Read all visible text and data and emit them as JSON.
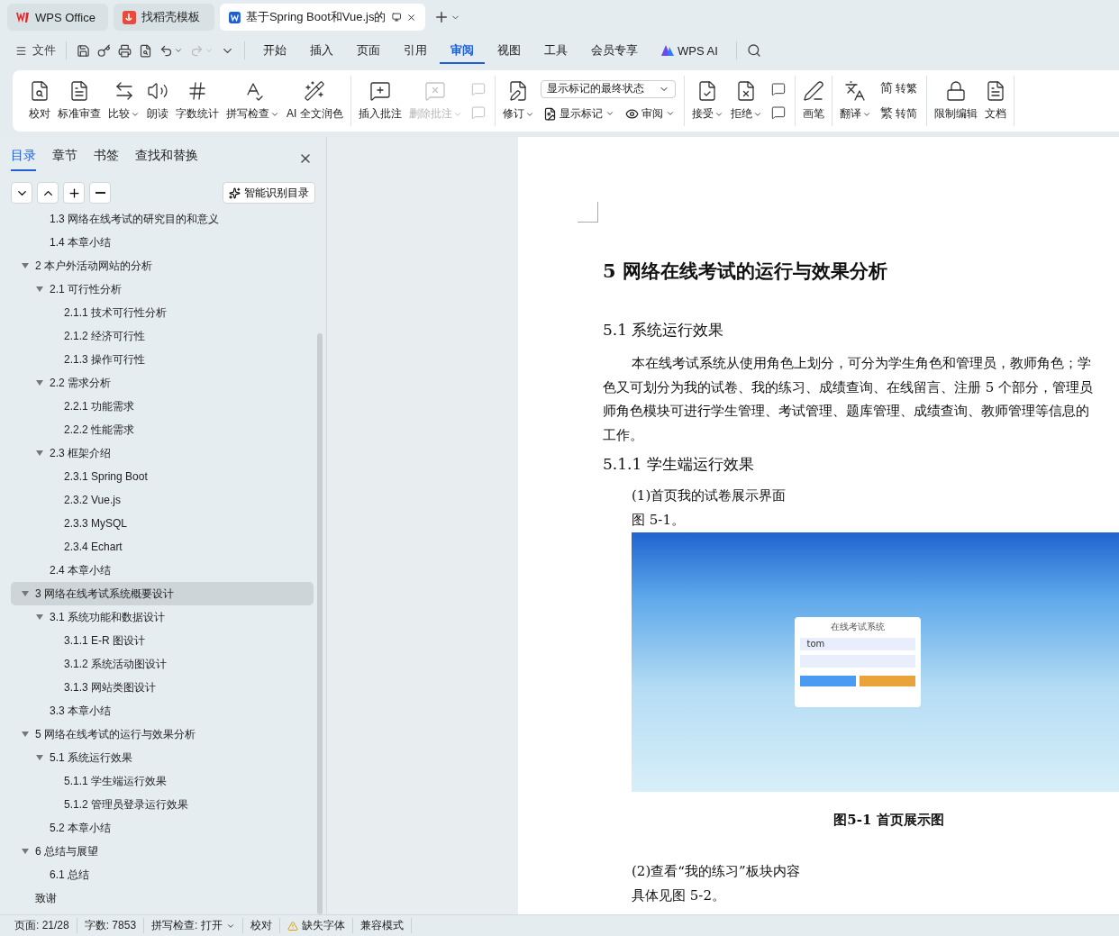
{
  "title_tabs": [
    {
      "label": "WPS Office",
      "kind": "home",
      "selected": false
    },
    {
      "label": "找稻壳模板",
      "kind": "template",
      "selected": false
    },
    {
      "label": "基于Spring Boot和Vue.js的",
      "kind": "doc",
      "selected": true
    }
  ],
  "menu": {
    "file": "文件",
    "tabs": [
      {
        "label": "开始",
        "selected": false
      },
      {
        "label": "插入",
        "selected": false
      },
      {
        "label": "页面",
        "selected": false
      },
      {
        "label": "引用",
        "selected": false
      },
      {
        "label": "审阅",
        "selected": true
      },
      {
        "label": "视图",
        "selected": false
      },
      {
        "label": "工具",
        "selected": false
      },
      {
        "label": "会员专享",
        "selected": false
      }
    ],
    "ai": "WPS AI"
  },
  "ribbon": [
    {
      "items": [
        {
          "kind": "large",
          "label": "校对",
          "caret": false,
          "disabled": false
        },
        {
          "kind": "large",
          "label": "标准审查",
          "caret": false,
          "disabled": false
        },
        {
          "kind": "large",
          "label": "比较",
          "caret": true,
          "disabled": false
        },
        {
          "kind": "large",
          "label": "朗读",
          "caret": false,
          "disabled": false
        },
        {
          "kind": "large",
          "label": "字数统计",
          "caret": false,
          "disabled": false
        },
        {
          "kind": "large",
          "label": "拼写检查",
          "caret": true,
          "disabled": false
        },
        {
          "kind": "large",
          "label": "AI 全文润色",
          "caret": false,
          "disabled": false
        }
      ]
    },
    {
      "items": [
        {
          "kind": "large",
          "label": "插入批注",
          "caret": false,
          "disabled": false
        },
        {
          "kind": "large",
          "label": "删除批注",
          "caret": true,
          "disabled": true
        },
        {
          "kind": "stack",
          "children": [
            {
              "caret": false,
              "disabled": true
            },
            {
              "caret": false,
              "disabled": true
            }
          ]
        }
      ]
    },
    {
      "items": [
        {
          "kind": "large",
          "label": "修订",
          "caret": true,
          "disabled": false
        },
        {
          "kind": "select",
          "value": "显示标记的最终状态",
          "children": [
            {
              "label": "显示标记",
              "caret": true,
              "disabled": false
            },
            {
              "label": "审阅",
              "caret": true,
              "disabled": false
            }
          ]
        }
      ]
    },
    {
      "items": [
        {
          "kind": "large",
          "label": "接受",
          "caret": true,
          "disabled": false
        },
        {
          "kind": "large",
          "label": "拒绝",
          "caret": true,
          "disabled": false
        },
        {
          "kind": "stack",
          "children": [
            {
              "caret": false,
              "disabled": false
            },
            {
              "caret": false,
              "disabled": false
            }
          ]
        }
      ]
    },
    {
      "items": [
        {
          "kind": "large",
          "label": "画笔",
          "caret": false,
          "disabled": false
        }
      ]
    },
    {
      "items": [
        {
          "kind": "large",
          "label": "翻译",
          "caret": true,
          "disabled": false
        },
        {
          "kind": "stack",
          "children": [
            {
              "glyph": "简",
              "label": "转繁",
              "caret": false,
              "disabled": false
            },
            {
              "glyph": "繁",
              "label": "转简",
              "caret": false,
              "disabled": false
            }
          ]
        }
      ]
    },
    {
      "items": [
        {
          "kind": "large",
          "label": "限制编辑",
          "caret": false,
          "disabled": false
        },
        {
          "kind": "large",
          "label": "文档",
          "caret": false,
          "disabled": false
        }
      ]
    }
  ],
  "sidebar": {
    "tabs": [
      {
        "label": "目录",
        "selected": true
      },
      {
        "label": "章节",
        "selected": false
      },
      {
        "label": "书签",
        "selected": false
      },
      {
        "label": "查找和替换",
        "selected": false
      }
    ],
    "smart_button": "智能识别目录",
    "tree": [
      {
        "children": [
          {
            "label": "1.3  网络在线考试的研究目的和意义",
            "selected": false
          },
          {
            "label": "1.4  本章小结",
            "selected": false
          }
        ]
      },
      {
        "label": "2  本户外活动网站的分析",
        "selected": false,
        "expanded": true,
        "children": [
          {
            "label": "2.1  可行性分析",
            "selected": false,
            "expanded": true,
            "children": [
              {
                "label": "2.1.1  技术可行性分析",
                "selected": false
              },
              {
                "label": "2.1.2  经济可行性",
                "selected": false
              },
              {
                "label": "2.1.3  操作可行性",
                "selected": false
              }
            ]
          },
          {
            "label": "2.2  需求分析",
            "selected": false,
            "expanded": true,
            "children": [
              {
                "label": "2.2.1  功能需求",
                "selected": false
              },
              {
                "label": "2.2.2  性能需求",
                "selected": false
              }
            ]
          },
          {
            "label": "2.3  框架介绍",
            "selected": false,
            "expanded": true,
            "children": [
              {
                "label": "2.3.1 Spring Boot",
                "selected": false
              },
              {
                "label": "2.3.2 Vue.js",
                "selected": false
              },
              {
                "label": "2.3.3 MySQL",
                "selected": false
              },
              {
                "label": "2.3.4 Echart",
                "selected": false
              }
            ]
          },
          {
            "label": "2.4  本章小结",
            "selected": false
          }
        ]
      },
      {
        "label": "3  网络在线考试系统概要设计",
        "selected": true,
        "expanded": true,
        "children": [
          {
            "label": "3.1  系统功能和数据设计",
            "selected": false,
            "expanded": true,
            "children": [
              {
                "label": "3.1.1 E-R 图设计",
                "selected": false
              },
              {
                "label": "3.1.2  系统活动图设计",
                "selected": false
              },
              {
                "label": "3.1.3  网站类图设计",
                "selected": false
              }
            ]
          },
          {
            "label": "3.3  本章小结",
            "selected": false
          }
        ]
      },
      {
        "label": "5  网络在线考试的运行与效果分析",
        "selected": false,
        "expanded": true,
        "children": [
          {
            "label": "5.1  系统运行效果",
            "selected": false,
            "expanded": true,
            "children": [
              {
                "label": "5.1.1  学生端运行效果",
                "selected": false
              },
              {
                "label": "5.1.2  管理员登录运行效果",
                "selected": false
              }
            ]
          },
          {
            "label": "5.2  本章小结",
            "selected": false
          }
        ]
      },
      {
        "label": "6  总结与展望",
        "selected": false,
        "expanded": true,
        "children": [
          {
            "label": "6.1  总结",
            "selected": false
          }
        ]
      },
      {
        "label": "致谢",
        "selected": false
      }
    ]
  },
  "document": {
    "chapter_title": "5  网络在线考试的运行与效果分析",
    "section_title": "5.1  系统运行效果",
    "paragraph_lines": [
      "本在线考试系统从使用角色上划分，可分为学生角色和管理员，教师角色；学",
      "色又可划分为我的试卷、我的练习、成绩查询、在线留言、注册 5 个部分，管理员",
      "师角色模块可进行学生管理、考试管理、题库管理、成绩查询、教师管理等信息的",
      "工作。"
    ],
    "subsection_title": "5.1.1  学生端运行效果",
    "item_1": "(1)首页我的试卷展示界面",
    "ref_1": "图 5-1。",
    "figure": {
      "login_title": "在线考试系统",
      "username": "tom"
    },
    "caption": "图5-1  首页展示图",
    "item_2": "(2)查看“我的练习”板块内容",
    "ref_2": "具体见图 5-2。"
  },
  "status_bar": [
    {
      "kind": "text",
      "label": "页面: 21/28"
    },
    {
      "kind": "text",
      "label": "字数: 7853"
    },
    {
      "kind": "menu",
      "label": "拼写检查: 打开"
    },
    {
      "kind": "text",
      "label": "校对"
    },
    {
      "kind": "warning",
      "label": "缺失字体"
    },
    {
      "kind": "text",
      "label": "兼容模式"
    }
  ]
}
